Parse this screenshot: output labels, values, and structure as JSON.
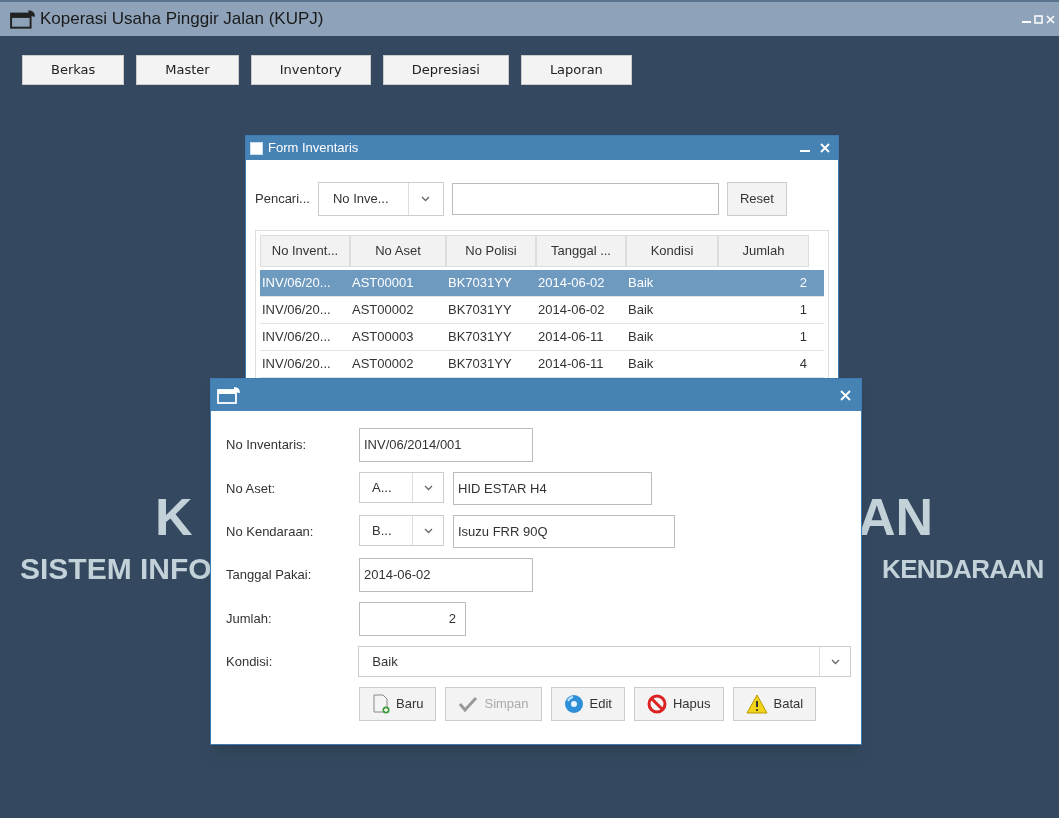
{
  "window": {
    "title": "Koperasi Usaha Pinggir Jalan (KUPJ)"
  },
  "menu": [
    "Berkas",
    "Master",
    "Inventory",
    "Depresiasi",
    "Laporan"
  ],
  "background_text": [
    "K",
    "AN",
    "SISTEM INFO",
    "KENDARAAN"
  ],
  "form_inventaris": {
    "title": "Form Inventaris",
    "search_label": "Pencari...",
    "search_combo": "No Inve...",
    "reset_button": "Reset",
    "table": {
      "columns": [
        "No Invent...",
        "No Aset",
        "No Polisi",
        "Tanggal ...",
        "Kondisi",
        "Jumlah"
      ],
      "rows": [
        {
          "selected": true,
          "cells": [
            "INV/06/20...",
            "AST00001",
            "BK7031YY",
            "2014-06-02",
            "Baik",
            "2"
          ]
        },
        {
          "selected": false,
          "cells": [
            "INV/06/20...",
            "AST00002",
            "BK7031YY",
            "2014-06-02",
            "Baik",
            "1"
          ]
        },
        {
          "selected": false,
          "cells": [
            "INV/06/20...",
            "AST00003",
            "BK7031YY",
            "2014-06-11",
            "Baik",
            "1"
          ]
        },
        {
          "selected": false,
          "cells": [
            "INV/06/20...",
            "AST00002",
            "BK7031YY",
            "2014-06-11",
            "Baik",
            "4"
          ]
        }
      ]
    }
  },
  "dialog": {
    "fields": [
      {
        "kind": "text",
        "label": "No Inventaris:",
        "value": "INV/06/2014/001"
      },
      {
        "kind": "combo_text",
        "label": "No Aset:",
        "combo": "A...",
        "value": "HID ESTAR H4"
      },
      {
        "kind": "combo_text",
        "label": "No Kendaraan:",
        "combo": "B...",
        "value": "Isuzu FRR 90Q"
      },
      {
        "kind": "text",
        "label": "Tanggal Pakai:",
        "value": "2014-06-02"
      },
      {
        "kind": "number",
        "label": "Jumlah:",
        "value": "2"
      },
      {
        "kind": "select",
        "label": "Kondisi:",
        "value": "Baik"
      }
    ],
    "buttons": [
      {
        "kind": "new",
        "label": "Baru",
        "disabled": false
      },
      {
        "kind": "save",
        "label": "Simpan",
        "disabled": true
      },
      {
        "kind": "edit",
        "label": "Edit",
        "disabled": false
      },
      {
        "kind": "delete",
        "label": "Hapus",
        "disabled": false
      },
      {
        "kind": "cancel",
        "label": "Batal",
        "disabled": false
      }
    ]
  }
}
